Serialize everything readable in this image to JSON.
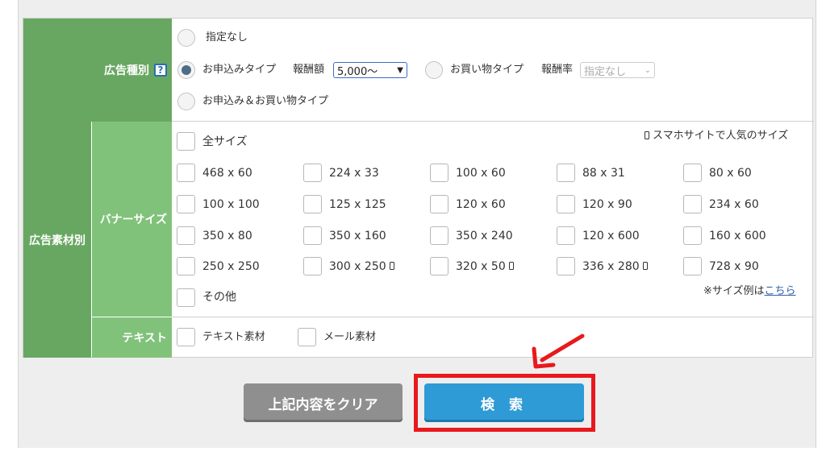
{
  "ad_type": {
    "header": "広告種別",
    "help_icon": "?",
    "options": {
      "none": "指定なし",
      "application": "お申込みタイプ",
      "shopping": "お買い物タイプ",
      "both": "お申込み＆お買い物タイプ"
    },
    "reward_amount_label": "報酬額",
    "reward_amount_value": "5,000〜",
    "reward_rate_label": "報酬率",
    "reward_rate_value": "指定なし",
    "selected": "application"
  },
  "material": {
    "header": "広告素材別",
    "banner_header": "バナーサイズ",
    "text_header": "テキスト",
    "all_sizes": "全サイズ",
    "smartphone_note": "スマホサイトで人気のサイズ",
    "sizes": [
      "468 x 60",
      "224 x 33",
      "100 x 60",
      "88 x 31",
      "80 x 60",
      "100 x 100",
      "125 x 125",
      "120 x 60",
      "120 x 90",
      "234 x 60",
      "350 x 80",
      "350 x 160",
      "350 x 240",
      "120 x 600",
      "160 x 600",
      "250 x 250",
      "300 x 250",
      "320 x 50",
      "336 x 280",
      "728 x 90"
    ],
    "other": "その他",
    "size_example_prefix": "※サイズ例は",
    "size_example_link": "こちら",
    "text_material": "テキスト素材",
    "mail_material": "メール素材"
  },
  "buttons": {
    "clear": "上記内容をクリア",
    "search": "検 索"
  },
  "colors": {
    "header_dark": "#68a761",
    "header_light": "#80c27a",
    "search_button": "#2f9bd6",
    "clear_button": "#8f8f8f",
    "highlight": "#e8191c"
  }
}
